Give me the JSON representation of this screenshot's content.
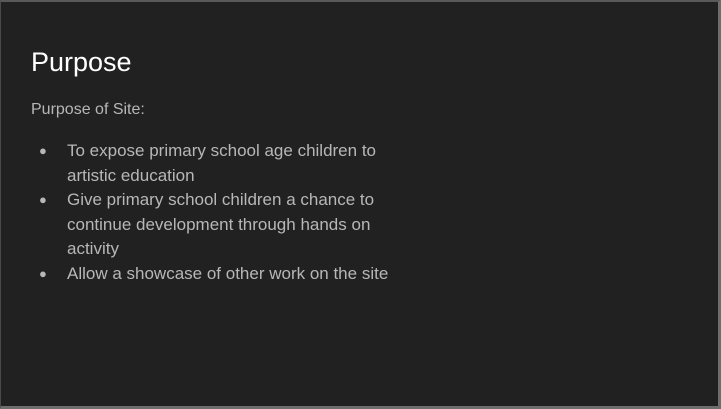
{
  "slide": {
    "title": "Purpose",
    "subtitle": "Purpose of Site:",
    "bullets": [
      "To expose primary school age children to artistic education",
      "Give primary school children a chance to continue development through hands on activity",
      "Allow a showcase of other work on the site"
    ],
    "bullet_glyph": "●"
  },
  "colors": {
    "background": "#212121",
    "title": "#ffffff",
    "body_text": "#b7b7b7"
  }
}
